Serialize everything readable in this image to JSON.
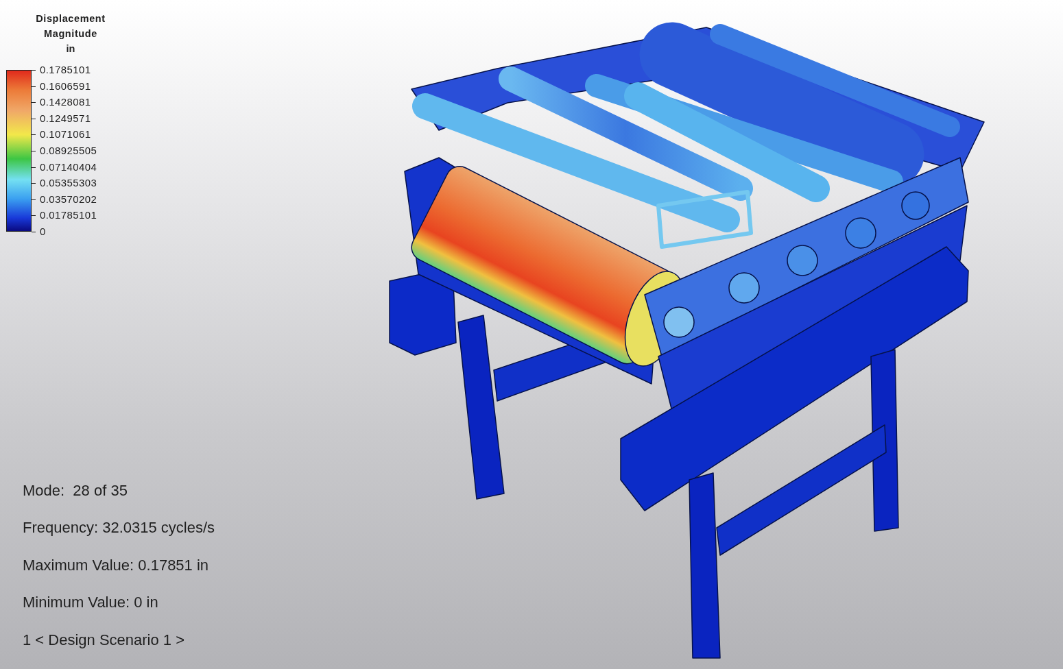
{
  "legend": {
    "title": "Displacement Magnitude",
    "unit": "in",
    "labels": [
      "0.1785101",
      "0.1606591",
      "0.1428081",
      "0.1249571",
      "0.1071061",
      "0.08925505",
      "0.07140404",
      "0.05355303",
      "0.03570202",
      "0.01785101",
      "0"
    ]
  },
  "info": [
    "Mode:  28 of 35",
    "Frequency: 32.0315 cycles/s",
    "Maximum Value: 0.17851 in",
    "Minimum Value: 0 in",
    "1 < Design Scenario 1 >"
  ]
}
